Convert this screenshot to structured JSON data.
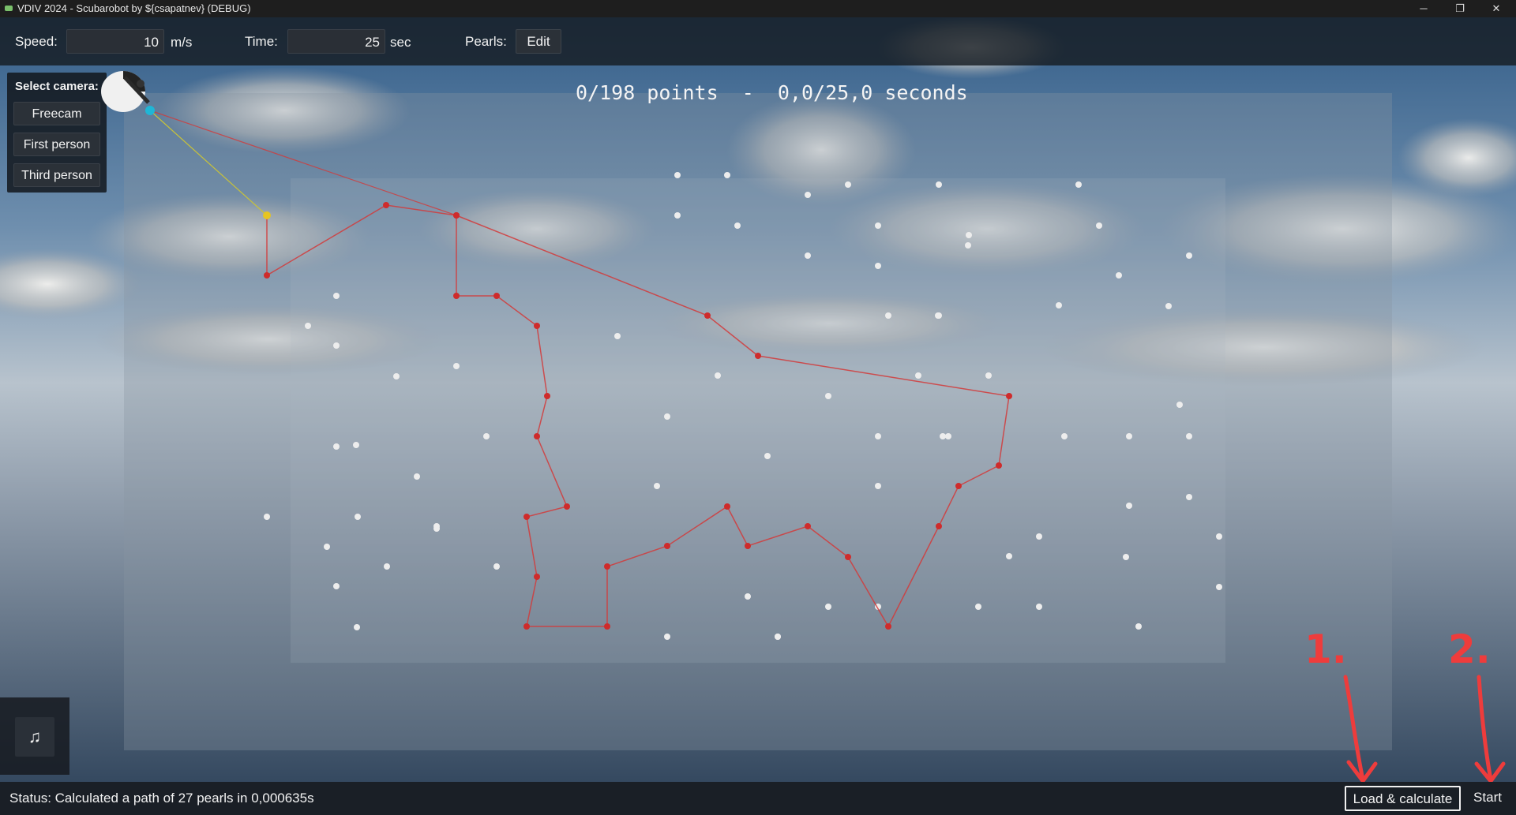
{
  "window": {
    "title": "VDIV 2024 - Scubarobot by ${csapatnev} (DEBUG)",
    "minimize_glyph": "─",
    "restore_glyph": "❐",
    "close_glyph": "✕"
  },
  "toolbar": {
    "speed_label": "Speed:",
    "speed_value": "10",
    "speed_unit": "m/s",
    "time_label": "Time:",
    "time_value": "25",
    "time_unit": "sec",
    "pearls_label": "Pearls:",
    "edit_label": "Edit"
  },
  "camera": {
    "title": "Select camera:",
    "options": [
      "Freecam",
      "First person",
      "Third person"
    ]
  },
  "hud": {
    "score": "0/198 points  -  0,0/25,0 seconds"
  },
  "music": {
    "icon": "music-note-icon",
    "glyph": "♫"
  },
  "status": {
    "text": "Status: Calculated a path of 27 pearls in 0,000635s",
    "load_label": "Load & calculate",
    "start_label": "Start"
  },
  "annotations": {
    "step1": "1.",
    "step2": "2."
  },
  "colors": {
    "path": "#d23a3a",
    "pearl": "#ededed",
    "visited_pearl": "#cf2b2b",
    "robot_marker": "#e6c520",
    "annotation": "#ee3c3c"
  }
}
